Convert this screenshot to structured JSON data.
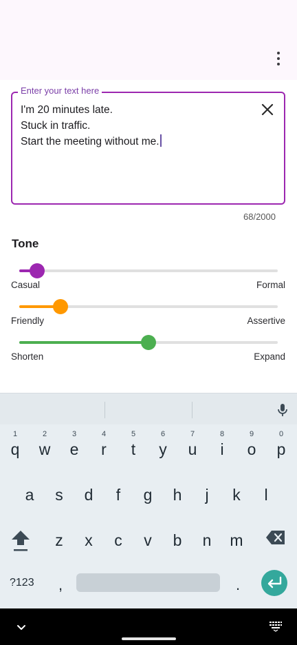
{
  "app": {
    "menu_icon": "more-vert-icon"
  },
  "editor": {
    "label": "Enter your text here",
    "lines": [
      "I'm 20 minutes late.",
      "Stuck in traffic.",
      "Start the meeting without me."
    ],
    "counter": "68/2000",
    "clear_icon": "close-icon"
  },
  "tone": {
    "title": "Tone",
    "sliders": [
      {
        "left_label": "Casual",
        "right_label": "Formal",
        "value": 0.07,
        "color": "#9c27b0"
      },
      {
        "left_label": "Friendly",
        "right_label": "Assertive",
        "value": 0.16,
        "color": "#ff9800"
      },
      {
        "left_label": "Shorten",
        "right_label": "Expand",
        "value": 0.5,
        "color": "#4caf50"
      }
    ]
  },
  "keyboard": {
    "row1": [
      "q",
      "w",
      "e",
      "r",
      "t",
      "y",
      "u",
      "i",
      "o",
      "p"
    ],
    "row1_hints": [
      "1",
      "2",
      "3",
      "4",
      "5",
      "6",
      "7",
      "8",
      "9",
      "0"
    ],
    "row2": [
      "a",
      "s",
      "d",
      "f",
      "g",
      "h",
      "j",
      "k",
      "l"
    ],
    "row3": [
      "z",
      "x",
      "c",
      "v",
      "b",
      "n",
      "m"
    ],
    "symbols_label": "?123",
    "comma": ",",
    "period": ".",
    "enter_color": "#34a89c",
    "icons": [
      "mic-icon",
      "shift-icon",
      "backspace-icon",
      "enter-icon"
    ]
  },
  "navbar": {
    "icons": [
      "chevron-down-icon",
      "keyboard-icon"
    ]
  }
}
